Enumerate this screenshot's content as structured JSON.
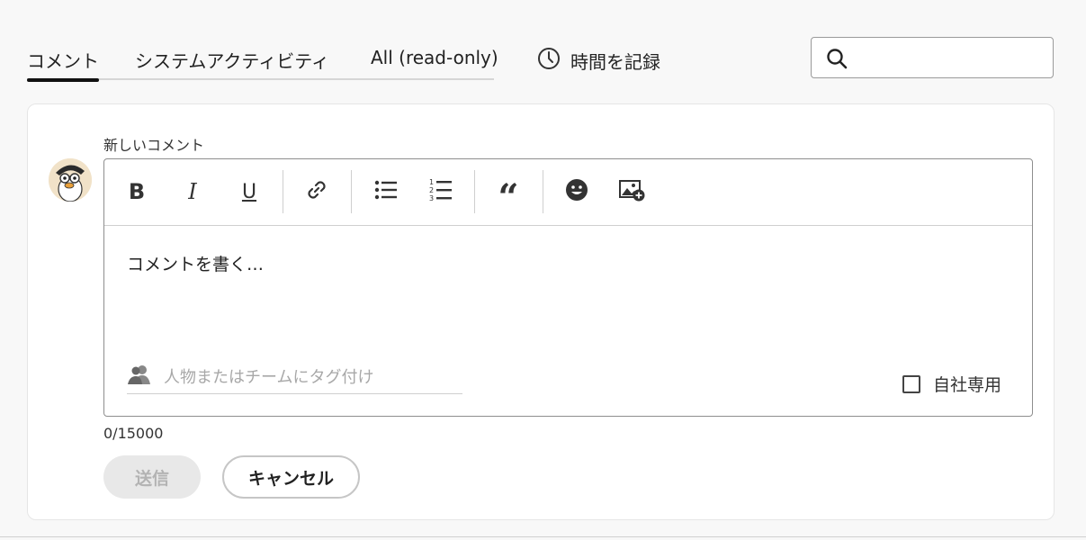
{
  "tabs": [
    {
      "label": "コメント",
      "active": true
    },
    {
      "label": "システムアクティビティ",
      "active": false
    },
    {
      "label": "All (read-only)",
      "active": false
    }
  ],
  "log_time": {
    "label": "時間を記録",
    "icon": "clock-icon"
  },
  "search": {
    "value": "",
    "placeholder": "",
    "icon": "search-icon"
  },
  "composer": {
    "heading": "新しいコメント",
    "toolbar": [
      {
        "name": "bold",
        "label": "B"
      },
      {
        "name": "italic",
        "label": "I"
      },
      {
        "name": "underline",
        "label": "U"
      },
      {
        "name": "link",
        "icon": "link-icon"
      },
      {
        "name": "bullet-list",
        "icon": "bullet-list-icon"
      },
      {
        "name": "numbered-list",
        "icon": "numbered-list-icon"
      },
      {
        "name": "quote",
        "icon": "quote-icon"
      },
      {
        "name": "emoji",
        "icon": "emoji-icon"
      },
      {
        "name": "insert-image",
        "icon": "insert-image-icon"
      }
    ],
    "placeholder": "コメントを書く…",
    "tag_placeholder": "人物またはチームにタグ付け",
    "internal_label": "自社専用",
    "internal_checked": false,
    "counter": "0/15000"
  },
  "buttons": {
    "send": "送信",
    "cancel": "キャンセル"
  },
  "colors": {
    "accent": "#111111",
    "disabled_bg": "#e8e8e8",
    "disabled_text": "#b3b3b3"
  }
}
